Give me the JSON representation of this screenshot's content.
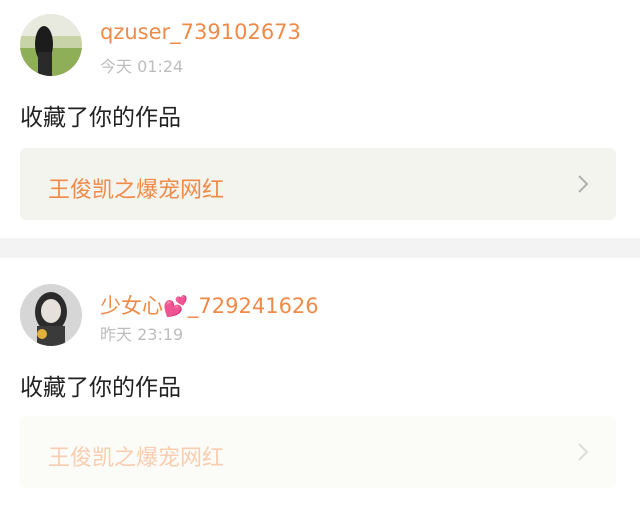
{
  "notifications": [
    {
      "username": "qzuser_739102673",
      "username_suffix": "",
      "timestamp": "今天 01:24",
      "action": "收藏了你的作品",
      "work_title": "王俊凯之爆宠网红",
      "avatar_icon": "girl-field-avatar"
    },
    {
      "username": "少女心",
      "username_emoji": "💕",
      "username_suffix": "_729241626",
      "timestamp": "昨天 23:19",
      "action": "收藏了你的作品",
      "work_title": "王俊凯之爆宠网红",
      "avatar_icon": "girl-bw-avatar"
    }
  ],
  "colors": {
    "accent": "#f08a48",
    "emoji_pink": "#e24a8d",
    "timestamp": "#bdbdbd",
    "card_bg": "#f4f4ee",
    "divider": "#f3f3f3"
  }
}
